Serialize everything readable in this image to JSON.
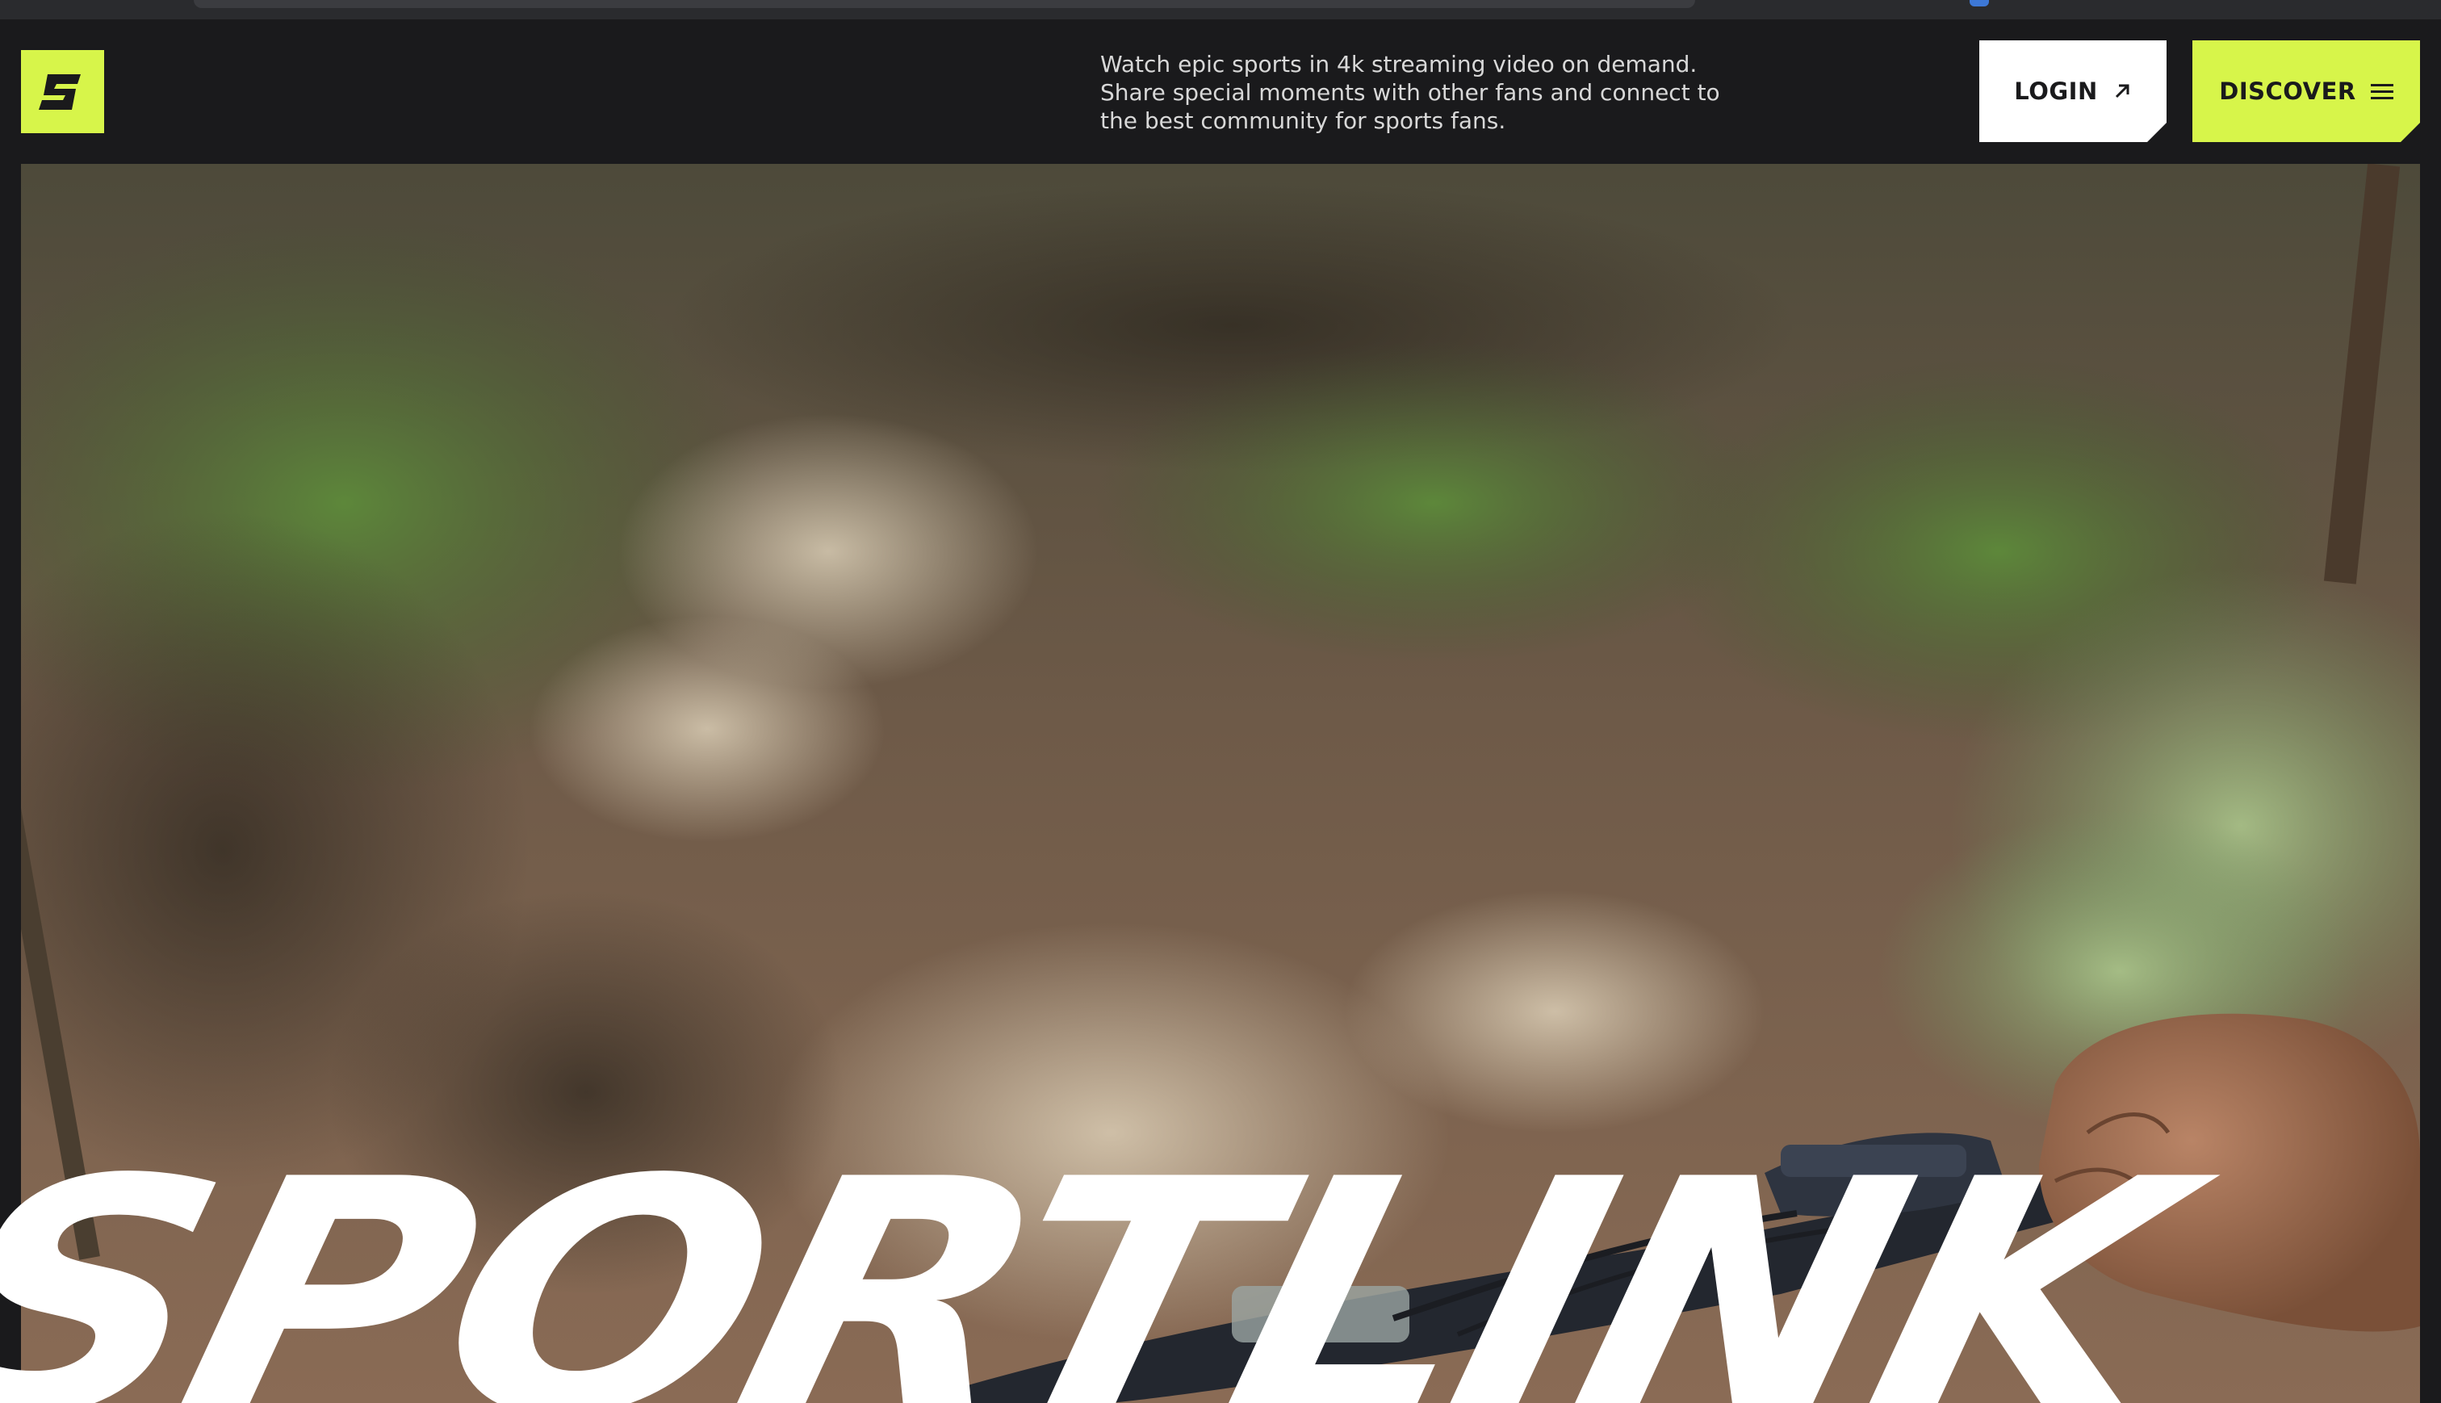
{
  "header": {
    "tagline": "Watch epic sports in 4k streaming video on demand.\nShare special moments with other fans and connect to\nthe best community for sports fans.",
    "login_label": "LOGIN",
    "discover_label": "DISCOVER"
  },
  "hero": {
    "wordmark": "SPORTLINK"
  },
  "icons": {
    "logo": "brand-s-icon",
    "login": "arrow-up-right-icon",
    "discover": "hamburger-menu-icon"
  },
  "colors": {
    "accent": "#d7f54a",
    "background": "#1a1a1c",
    "text_light": "#d8d8d8",
    "button_light": "#ffffff"
  }
}
